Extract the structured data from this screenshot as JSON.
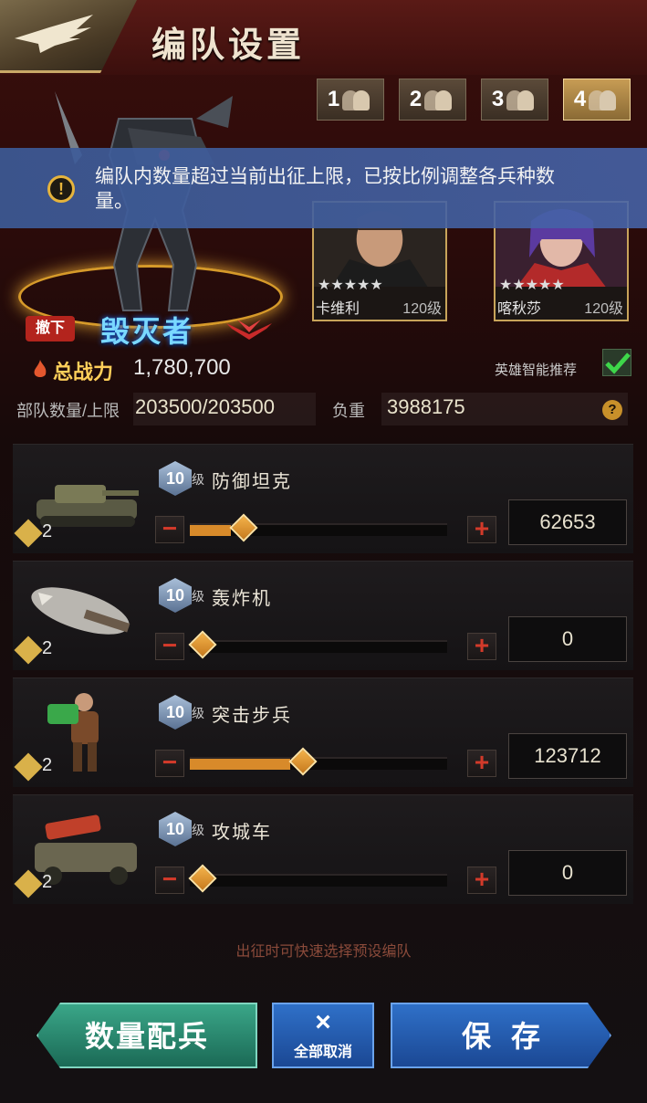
{
  "header": {
    "title": "编队设置"
  },
  "team_tabs": [
    {
      "label": "1",
      "active": false
    },
    {
      "label": "2",
      "active": false
    },
    {
      "label": "3",
      "active": false
    },
    {
      "label": "4",
      "active": true
    }
  ],
  "notice": {
    "text": "编队内数量超过当前出征上限，已按比例调整各兵种数量。"
  },
  "mech": {
    "name": "毁灭者",
    "undeploy_label": "撤下"
  },
  "power": {
    "label": "总战力",
    "value": "1,780,700"
  },
  "heroes": [
    {
      "name": "卡维利",
      "level": "120级",
      "stars": "★★★★★"
    },
    {
      "name": "喀秋莎",
      "level": "120级",
      "stars": "★★★★★"
    }
  ],
  "ai_recommend": {
    "label": "英雄智能推荐",
    "checked": true
  },
  "stats": {
    "troops_label": "部队数量/上限",
    "troops_value": "203500/203500",
    "load_label": "负重",
    "load_value": "3988175"
  },
  "units": [
    {
      "level": "10",
      "level_suffix": "级",
      "name": "防御坦克",
      "badge": "2",
      "quantity": "62653",
      "fraction": 0.16
    },
    {
      "level": "10",
      "level_suffix": "级",
      "name": "轰炸机",
      "badge": "2",
      "quantity": "0",
      "fraction": 0.0
    },
    {
      "level": "10",
      "level_suffix": "级",
      "name": "突击步兵",
      "badge": "2",
      "quantity": "123712",
      "fraction": 0.39
    },
    {
      "level": "10",
      "level_suffix": "级",
      "name": "攻城车",
      "badge": "2",
      "quantity": "0",
      "fraction": 0.0
    }
  ],
  "tip": "出征时可快速选择预设编队",
  "buttons": {
    "army": "数量配兵",
    "cancel_icon": "×",
    "cancel_all": "全部取消",
    "save": "保存"
  },
  "colors": {
    "accent_gold": "#d88a2a",
    "button_blue": "#2f70c8",
    "button_green": "#3aa688"
  }
}
